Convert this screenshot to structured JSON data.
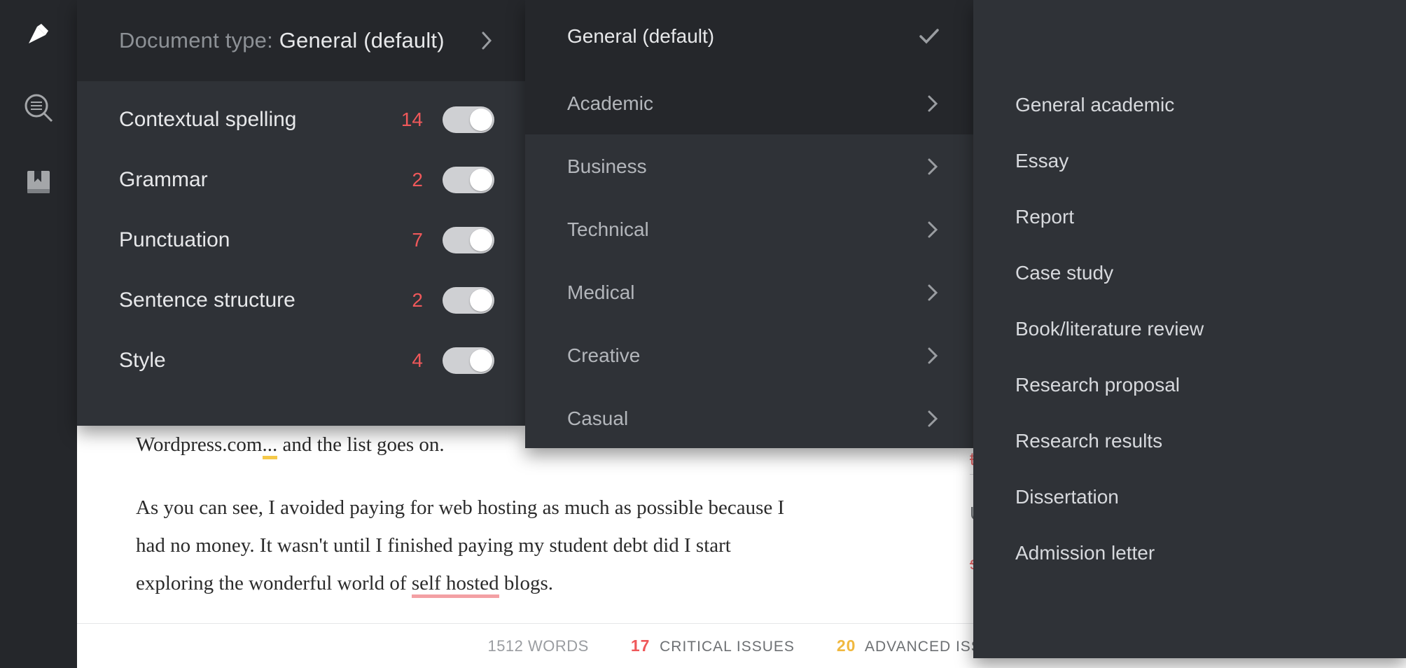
{
  "docType": {
    "label": "Document type:",
    "value": "General (default)"
  },
  "checks": [
    {
      "name": "Contextual spelling",
      "count": "14"
    },
    {
      "name": "Grammar",
      "count": "2"
    },
    {
      "name": "Punctuation",
      "count": "7"
    },
    {
      "name": "Sentence structure",
      "count": "2"
    },
    {
      "name": "Style",
      "count": "4"
    }
  ],
  "categories": [
    {
      "label": "General (default)",
      "selected": true
    },
    {
      "label": "Academic",
      "hover": true
    },
    {
      "label": "Business"
    },
    {
      "label": "Technical"
    },
    {
      "label": "Medical"
    },
    {
      "label": "Creative"
    },
    {
      "label": "Casual"
    }
  ],
  "subcategories": [
    "General academic",
    "Essay",
    "Report",
    "Case study",
    "Book/literature review",
    "Research proposal",
    "Research results",
    "Dissertation",
    "Admission letter"
  ],
  "doc": {
    "line1_a": "Wordpress.com",
    "line1_b": "...",
    "line1_c": " and the list goes on.",
    "para2_a": "As you can see, I avoided paying for web hosting as much as possible because I had no money. It wasn't until I finished paying my student debt did I start exploring the wonderful world of ",
    "para2_u": "self hosted",
    "para2_b": " blogs."
  },
  "issues": {
    "s1": "tumblr",
    "t1": "Unnecess",
    "s2": "self hoste"
  },
  "status": {
    "words_n": "1512",
    "words_l": "WORDS",
    "critical_n": "17",
    "critical_l": "CRITICAL ISSUES",
    "advanced_n": "20",
    "advanced_l": "ADVANCED ISSUES"
  }
}
